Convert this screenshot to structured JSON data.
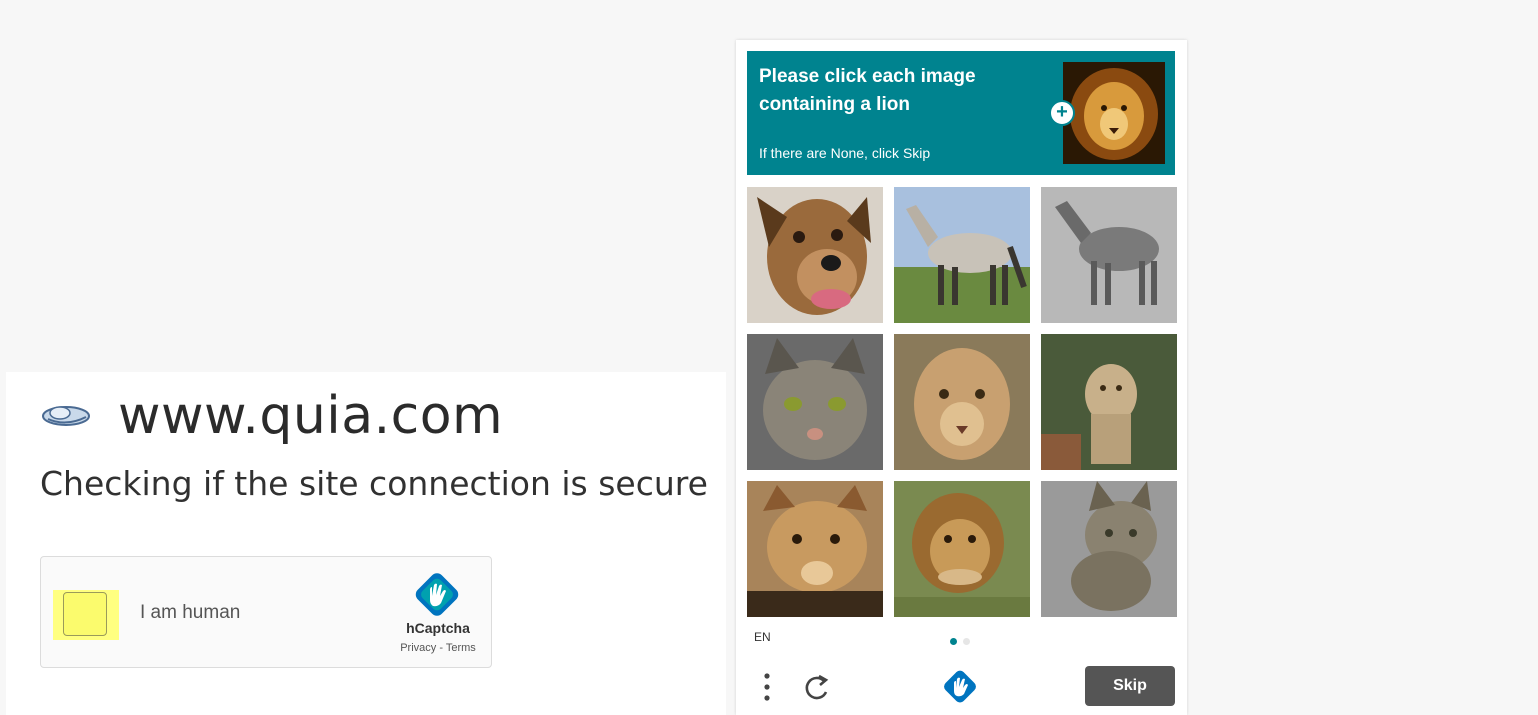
{
  "site": {
    "name": "www.quia.com",
    "status": "Checking if the site connection is secure"
  },
  "widget": {
    "checkbox_label": "I am human",
    "brand": "hCaptcha",
    "privacy": "Privacy",
    "separator": " - ",
    "terms": "Terms"
  },
  "challenge": {
    "prompt_title": "Please click each image containing a lion",
    "prompt_subtitle": "If there are None, click Skip",
    "example_plus": "+",
    "language": "EN",
    "skip_label": "Skip",
    "tiles": [
      {
        "subject": "dog"
      },
      {
        "subject": "horse"
      },
      {
        "subject": "horse"
      },
      {
        "subject": "cat"
      },
      {
        "subject": "lion"
      },
      {
        "subject": "lion"
      },
      {
        "subject": "lion"
      },
      {
        "subject": "lion"
      },
      {
        "subject": "cat"
      }
    ],
    "pages": 2,
    "current_page": 1
  },
  "colors": {
    "accent": "#00838f",
    "highlight": "#ffff80",
    "skip_button": "#555555"
  }
}
